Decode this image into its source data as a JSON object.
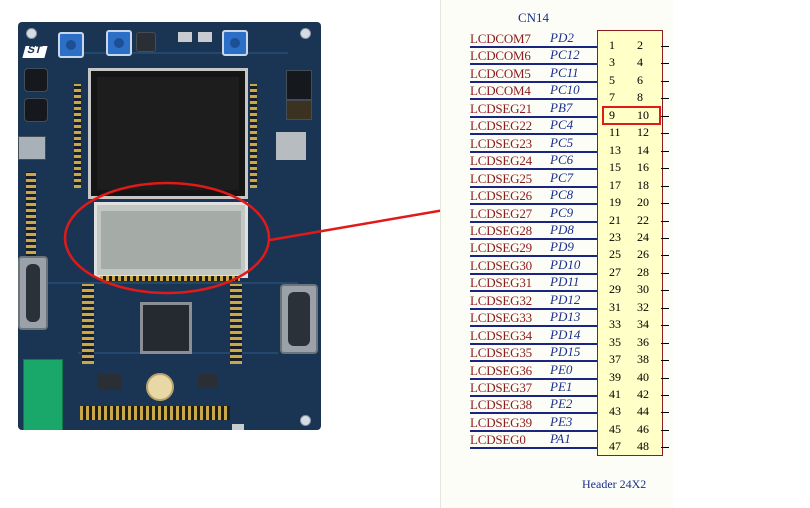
{
  "schematic": {
    "connector_name": "CN14",
    "connector_footer": "Header 24X2",
    "signals": [
      {
        "name": "LCDCOM7",
        "port": "PD2"
      },
      {
        "name": "LCDCOM6",
        "port": "PC12"
      },
      {
        "name": "LCDCOM5",
        "port": "PC11"
      },
      {
        "name": "LCDCOM4",
        "port": "PC10"
      },
      {
        "name": "LCDSEG21",
        "port": "PB7"
      },
      {
        "name": "LCDSEG22",
        "port": "PC4"
      },
      {
        "name": "LCDSEG23",
        "port": "PC5"
      },
      {
        "name": "LCDSEG24",
        "port": "PC6"
      },
      {
        "name": "LCDSEG25",
        "port": "PC7"
      },
      {
        "name": "LCDSEG26",
        "port": "PC8"
      },
      {
        "name": "LCDSEG27",
        "port": "PC9"
      },
      {
        "name": "LCDSEG28",
        "port": "PD8"
      },
      {
        "name": "LCDSEG29",
        "port": "PD9"
      },
      {
        "name": "LCDSEG30",
        "port": "PD10"
      },
      {
        "name": "LCDSEG31",
        "port": "PD11"
      },
      {
        "name": "LCDSEG32",
        "port": "PD12"
      },
      {
        "name": "LCDSEG33",
        "port": "PD13"
      },
      {
        "name": "LCDSEG34",
        "port": "PD14"
      },
      {
        "name": "LCDSEG35",
        "port": "PD15"
      },
      {
        "name": "LCDSEG36",
        "port": "PE0"
      },
      {
        "name": "LCDSEG37",
        "port": "PE1"
      },
      {
        "name": "LCDSEG38",
        "port": "PE2"
      },
      {
        "name": "LCDSEG39",
        "port": "PE3"
      },
      {
        "name": "LCDSEG0",
        "port": "PA1"
      }
    ],
    "pins_odd": [
      "1",
      "3",
      "5",
      "7",
      "9",
      "11",
      "13",
      "15",
      "17",
      "19",
      "21",
      "23",
      "25",
      "27",
      "29",
      "31",
      "33",
      "35",
      "37",
      "39",
      "41",
      "43",
      "45",
      "47"
    ],
    "pins_even": [
      "2",
      "4",
      "6",
      "8",
      "10",
      "12",
      "14",
      "16",
      "18",
      "20",
      "22",
      "24",
      "26",
      "28",
      "30",
      "32",
      "34",
      "36",
      "38",
      "40",
      "42",
      "44",
      "46",
      "48"
    ],
    "highlighted_pins": [
      "9",
      "10"
    ]
  },
  "board": {
    "logo_text": "ST",
    "highlight_color": "#e01919"
  },
  "colors": {
    "signal_name": "#8b1c1c",
    "port_name": "#1a2f8a",
    "header_fill": "#ffffc8",
    "pcb": "#1a3553",
    "highlight": "#e01919"
  }
}
